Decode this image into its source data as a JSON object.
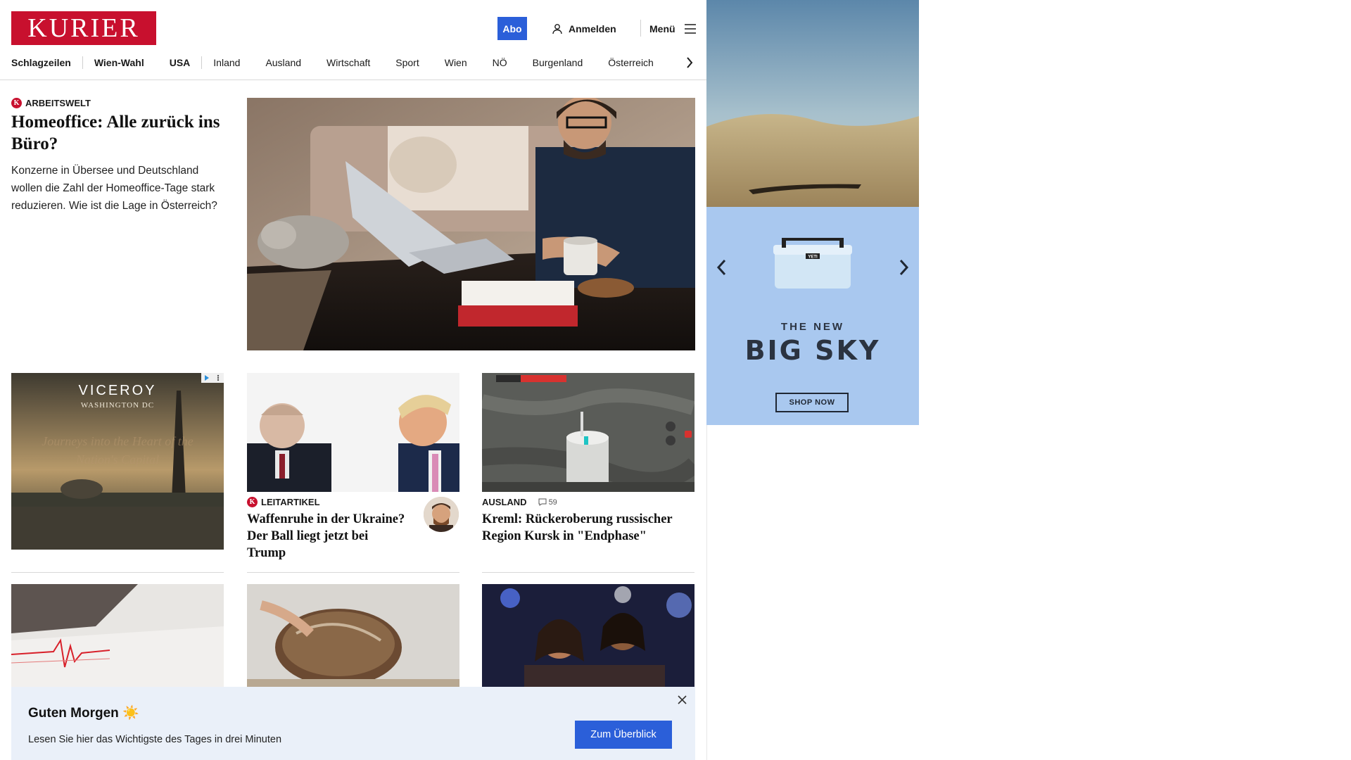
{
  "header": {
    "logo": "KURIER",
    "abo_label": "Abo",
    "login_label": "Anmelden",
    "menu_label": "Menü"
  },
  "nav": {
    "items": [
      "Schlagzeilen",
      "Wien-Wahl",
      "USA",
      "Inland",
      "Ausland",
      "Wirtschaft",
      "Sport",
      "Wien",
      "NÖ",
      "Burgenland",
      "Österreich"
    ]
  },
  "hero": {
    "category": "ARBEITSWELT",
    "title": "Homeoffice: Alle zurück ins Büro?",
    "teaser": "Konzerne in Übersee und Deutschland wollen die Zahl der Homeoffice-Tage stark reduzieren. Wie ist die Lage in Österreich?"
  },
  "ad_left": {
    "brand": "VICEROY",
    "sub": "WASHINGTON DC",
    "tagline": "Journeys into the Heart of the Nation's Capital"
  },
  "cards": [
    {
      "category": "LEITARTIKEL",
      "title": "Waffenruhe in der Ukraine? Der Ball liegt jetzt bei Trump"
    },
    {
      "category": "AUSLAND",
      "comments": "59",
      "title": "Kreml: Rückeroberung russischer Region Kursk in \"Endphase\""
    }
  ],
  "banner": {
    "title": "Guten Morgen ☀️",
    "text": "Lesen Sie hier das Wichtigste des Tages in drei Minuten",
    "button": "Zum Überblick"
  },
  "right_ad": {
    "product_label": "YETI",
    "line1": "THE NEW",
    "line2": "BIG SKY",
    "button": "SHOP NOW"
  },
  "colors": {
    "brand_red": "#c8102e",
    "accent_blue": "#2b5fd9",
    "banner_bg": "#eaf0f9",
    "ad_blue": "#a9c8ef"
  }
}
